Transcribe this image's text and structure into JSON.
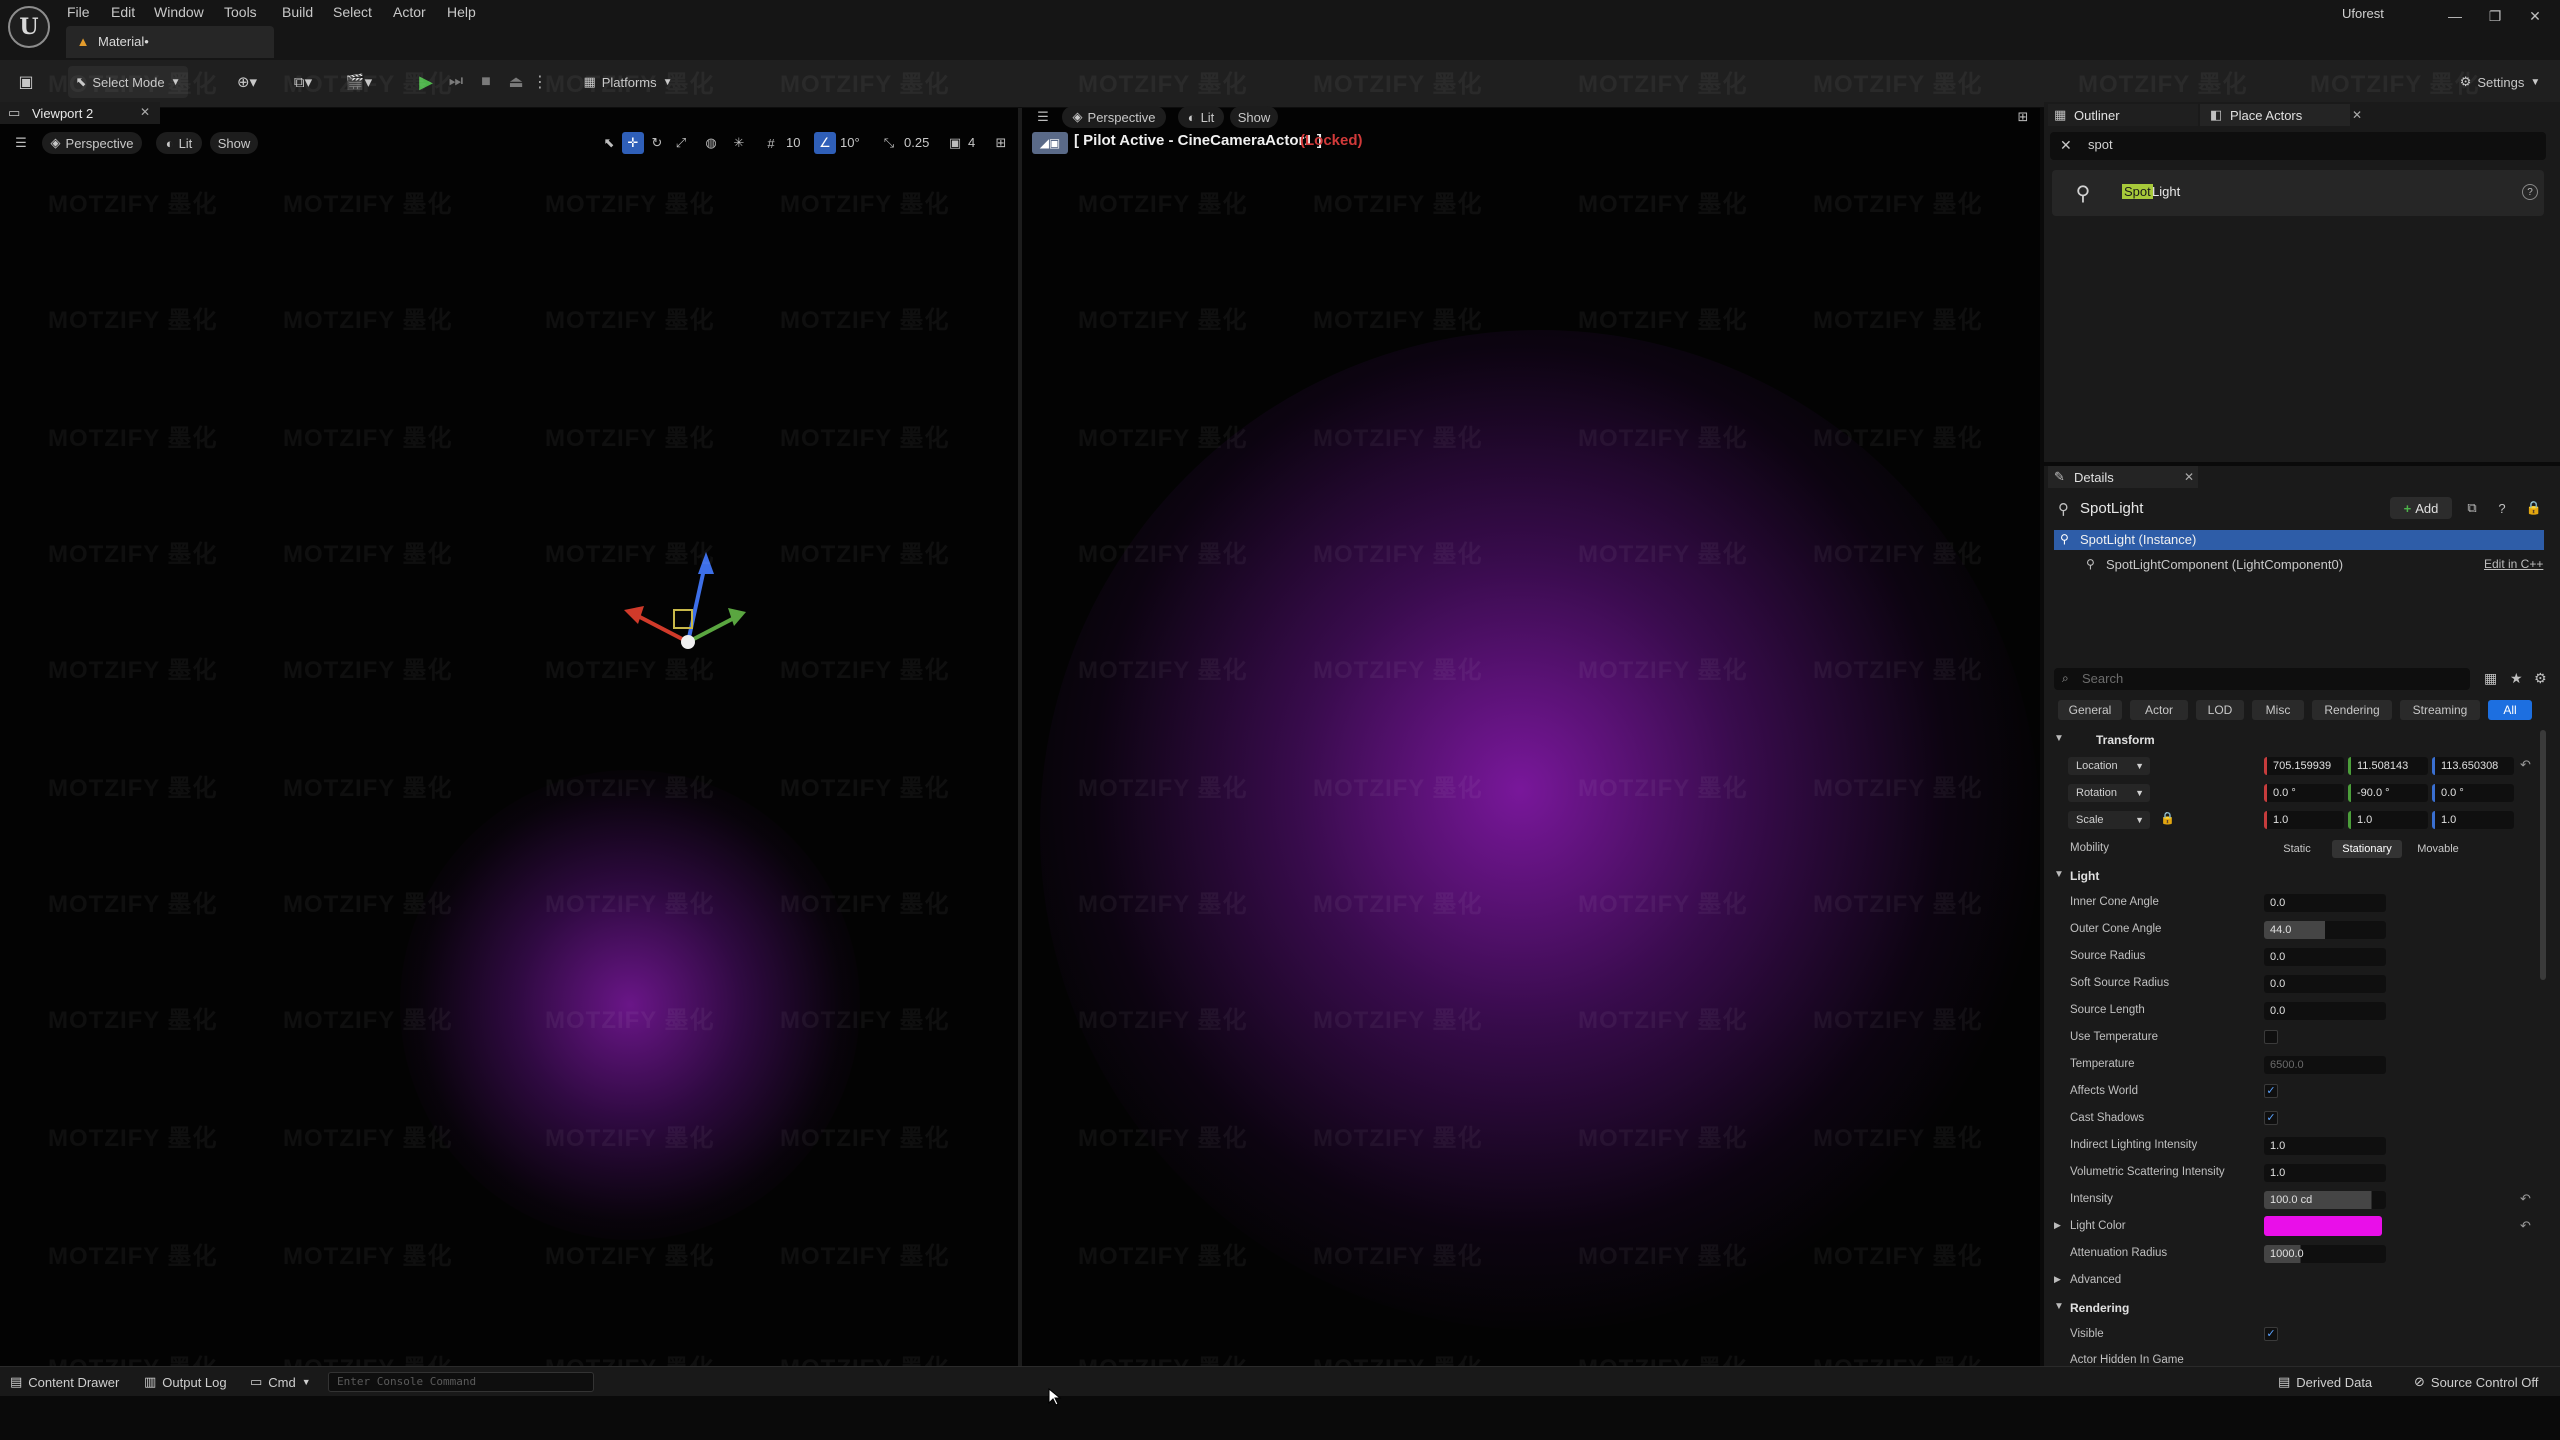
{
  "menu": {
    "items": [
      "File",
      "Edit",
      "Window",
      "Tools",
      "Build",
      "Select",
      "Actor",
      "Help"
    ],
    "document_tab": "Material•",
    "project_name": "Uforest"
  },
  "toolbar": {
    "select_mode": "Select Mode",
    "platforms": "Platforms",
    "settings": "Settings"
  },
  "viewport_left": {
    "tab_label": "Viewport 2",
    "perspective": "Perspective",
    "lit": "Lit",
    "show": "Show",
    "grid_size": "10",
    "rotation_snap": "10°",
    "scale_snap": "0.25",
    "camera_speed": "4"
  },
  "viewport_right": {
    "perspective": "Perspective",
    "lit": "Lit",
    "show": "Show",
    "pilot_label": "[ Pilot Active - CineCameraActor1 ]",
    "locked_label": "(Locked)"
  },
  "watermark": "MOTZIFY 墨化",
  "outliner": {
    "tab_outliner": "Outliner",
    "tab_place_actors": "Place Actors",
    "search_value": "spot",
    "result_highlight": "Spot",
    "result_rest": " Light"
  },
  "details": {
    "tab_label": "Details",
    "actor_name": "SpotLight",
    "add_label": "Add",
    "instance_label": "SpotLight (Instance)",
    "component_label": "SpotLightComponent (LightComponent0)",
    "edit_cpp": "Edit in C++",
    "search_placeholder": "Search",
    "filters": [
      "General",
      "Actor",
      "LOD",
      "Misc",
      "Rendering",
      "Streaming",
      "All"
    ],
    "transform": {
      "header": "Transform",
      "location_label": "Location",
      "location": [
        "705.159939",
        "11.508143",
        "113.650308"
      ],
      "rotation_label": "Rotation",
      "rotation": [
        "0.0 °",
        "-90.0 °",
        "0.0 °"
      ],
      "scale_label": "Scale",
      "scale": [
        "1.0",
        "1.0",
        "1.0"
      ],
      "mobility_label": "Mobility",
      "mobility_options": [
        "Static",
        "Stationary",
        "Movable"
      ]
    },
    "light": {
      "header": "Light",
      "inner_cone_angle": {
        "label": "Inner Cone Angle",
        "value": "0.0"
      },
      "outer_cone_angle": {
        "label": "Outer Cone Angle",
        "value": "44.0"
      },
      "source_radius": {
        "label": "Source Radius",
        "value": "0.0"
      },
      "soft_source_radius": {
        "label": "Soft Source Radius",
        "value": "0.0"
      },
      "source_length": {
        "label": "Source Length",
        "value": "0.0"
      },
      "use_temperature": {
        "label": "Use Temperature"
      },
      "temperature": {
        "label": "Temperature",
        "value": "6500.0"
      },
      "affects_world": {
        "label": "Affects World"
      },
      "cast_shadows": {
        "label": "Cast Shadows"
      },
      "indirect_lighting": {
        "label": "Indirect Lighting Intensity",
        "value": "1.0"
      },
      "volumetric_scattering": {
        "label": "Volumetric Scattering Intensity",
        "value": "1.0"
      },
      "intensity": {
        "label": "Intensity",
        "value": "100.0 cd"
      },
      "light_color": {
        "label": "Light Color",
        "color": "#e90fe9"
      },
      "attenuation_radius": {
        "label": "Attenuation Radius",
        "value": "1000.0"
      },
      "advanced": "Advanced"
    },
    "rendering": {
      "header": "Rendering",
      "visible": "Visible",
      "actor_hidden": "Actor Hidden In Game"
    }
  },
  "statusbar": {
    "content_drawer": "Content Drawer",
    "output_log": "Output Log",
    "cmd": "Cmd",
    "console_placeholder": "Enter Console Command",
    "derived_data": "Derived Data",
    "source_control": "Source Control Off"
  },
  "colors": {
    "accent_blue": "#2e5da8",
    "light_color": "#e90fe9",
    "locked_red": "#d23a3a"
  }
}
